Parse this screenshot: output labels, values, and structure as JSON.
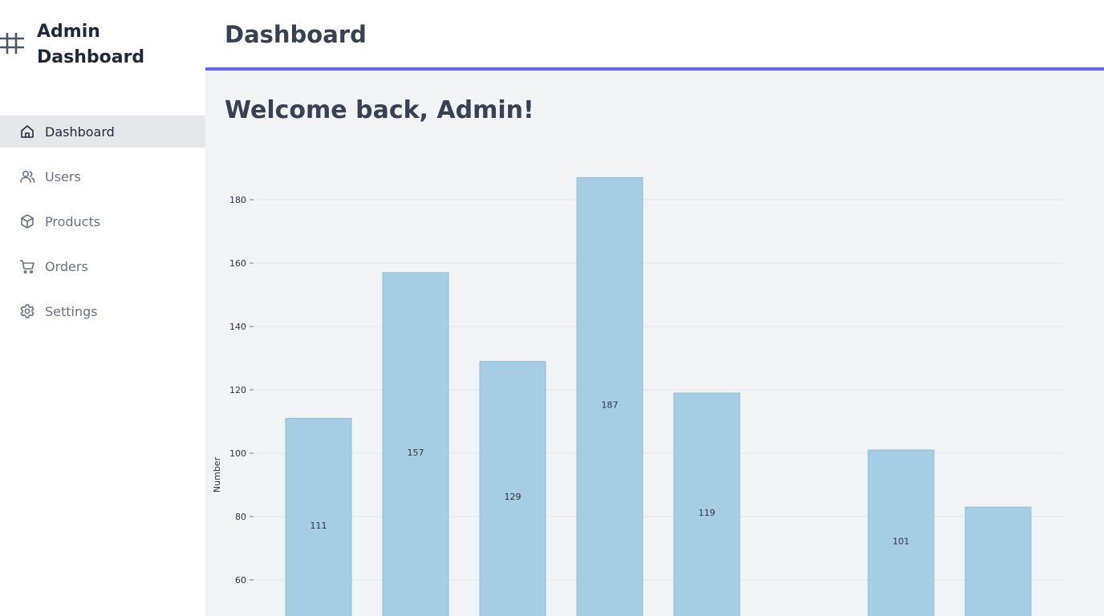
{
  "brand": {
    "title": "Admin Dashboard",
    "icon": "hash-icon"
  },
  "nav": [
    {
      "label": "Dashboard",
      "icon": "home-icon",
      "active": true
    },
    {
      "label": "Users",
      "icon": "users-icon",
      "active": false
    },
    {
      "label": "Products",
      "icon": "box-icon",
      "active": false
    },
    {
      "label": "Orders",
      "icon": "cart-icon",
      "active": false
    },
    {
      "label": "Settings",
      "icon": "gear-icon",
      "active": false
    }
  ],
  "header": {
    "title": "Dashboard",
    "accent_color": "#6366f1"
  },
  "main": {
    "welcome": "Welcome back, Admin!"
  },
  "chart_data": {
    "type": "bar",
    "ylabel": "Number",
    "values": [
      111,
      157,
      129,
      187,
      119,
      null,
      101,
      83
    ],
    "data_labels": [
      "111",
      "157",
      "129",
      "187",
      "119",
      "",
      "101",
      ""
    ],
    "yticks": [
      60,
      80,
      100,
      120,
      140,
      160,
      180
    ],
    "bar_color": "#a6cde2",
    "grid": true
  }
}
